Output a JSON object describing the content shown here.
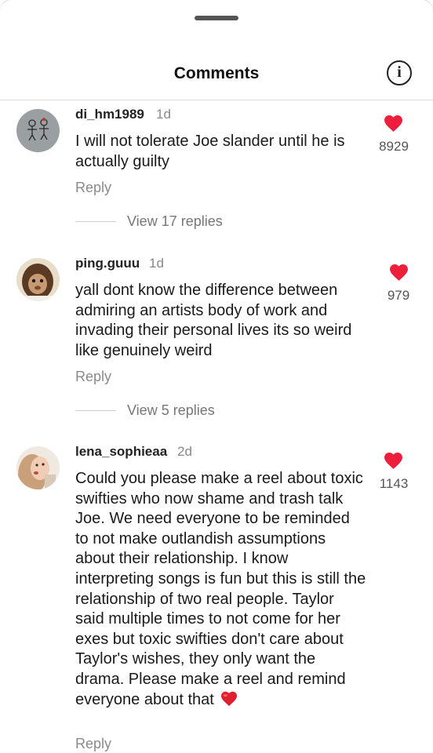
{
  "header": {
    "title": "Comments"
  },
  "comments": [
    {
      "username": "di_hm1989",
      "time": "1d",
      "text": "I will not tolerate Joe slander until he is actually guilty",
      "likes": "8929",
      "reply_label": "Reply",
      "view_replies": "View 17 replies"
    },
    {
      "username": "ping.guuu",
      "time": "1d",
      "text": "yall dont know the difference between admiring an artists body of work and invading their personal lives its so weird like genuinely weird",
      "likes": "979",
      "reply_label": "Reply",
      "view_replies": "View 5 replies"
    },
    {
      "username": "lena_sophieaa",
      "time": "2d",
      "text": "Could you please make a reel about toxic swifties who now shame and trash talk Joe. We need everyone to be reminded to not make outlandish assumptions about their relationship. I know interpreting songs is fun but this is still the relationship of two real people. Taylor said multiple times to not come for her exes but toxic swifties don't care about Taylor's wishes, they only want the drama. Please make a reel and remind everyone about that",
      "likes": "1143",
      "reply_label": "Reply"
    }
  ],
  "colors": {
    "like_red": "#ed1f3d",
    "text_primary": "#1a1a1a",
    "text_secondary": "#888888"
  },
  "icons": {
    "info": "info-icon",
    "like": "heart-icon",
    "emoji": "red-heart-emoji-icon"
  }
}
